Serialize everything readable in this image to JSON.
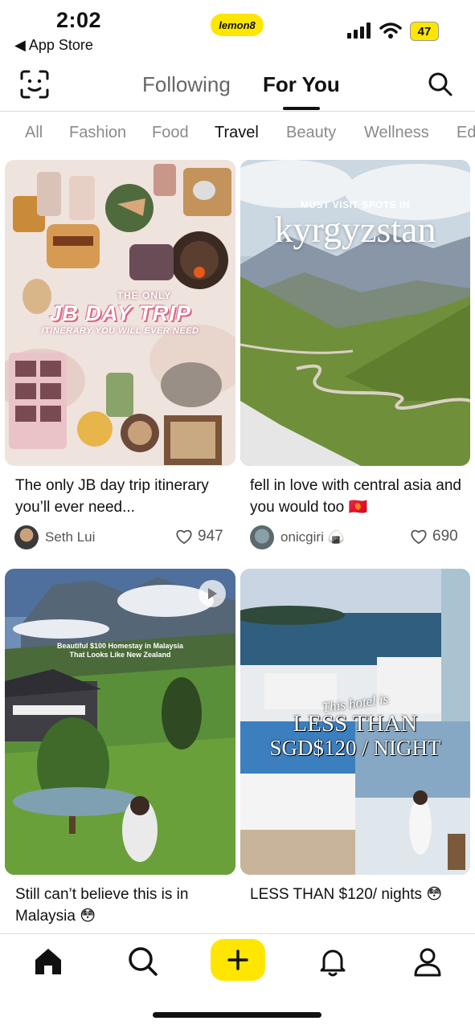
{
  "status_bar": {
    "time": "2:02",
    "back_label": "◀ App Store",
    "brand_pill": "lemon8",
    "battery": "47"
  },
  "header": {
    "tabs": [
      "Following",
      "For You"
    ],
    "active_tab": "For You"
  },
  "categories": [
    "All",
    "Fashion",
    "Food",
    "Travel",
    "Beauty",
    "Wellness",
    "Ed"
  ],
  "active_category": "Travel",
  "posts": [
    {
      "title": "The only JB day trip itinerary you’ll ever need...",
      "author": "Seth Lui",
      "likes": "947",
      "image_text": {
        "line1": "THE ONLY",
        "line2": "JB DAY TRIP",
        "line3": "ITINERARY YOU WILL EVER NEED"
      }
    },
    {
      "title": "fell in love with central asia and you would too 🇰🇬",
      "author": "onicgiri 🍙",
      "likes": "690",
      "image_text": {
        "line1": "MUST VISIT SPOTS IN",
        "line2": "kyrgyzstan"
      }
    },
    {
      "title": "Still can’t believe this is in Malaysia 😳",
      "image_text": {
        "line1": "Beautiful $100 Homestay in Malaysia",
        "line2": "That Looks Like New Zealand"
      }
    },
    {
      "title": "LESS THAN $120/ nights 😳",
      "image_text": {
        "line1": "This hotel is",
        "line2": "LESS THAN",
        "line3": "SGD$120 / NIGHT"
      }
    }
  ],
  "colors": {
    "accent": "#ffe600",
    "text": "#111111",
    "muted": "#8a8a8a"
  },
  "icons": [
    "face-scan-icon",
    "search-icon",
    "heart-icon",
    "play-icon",
    "home-icon",
    "plus-icon",
    "bell-icon",
    "profile-icon"
  ]
}
